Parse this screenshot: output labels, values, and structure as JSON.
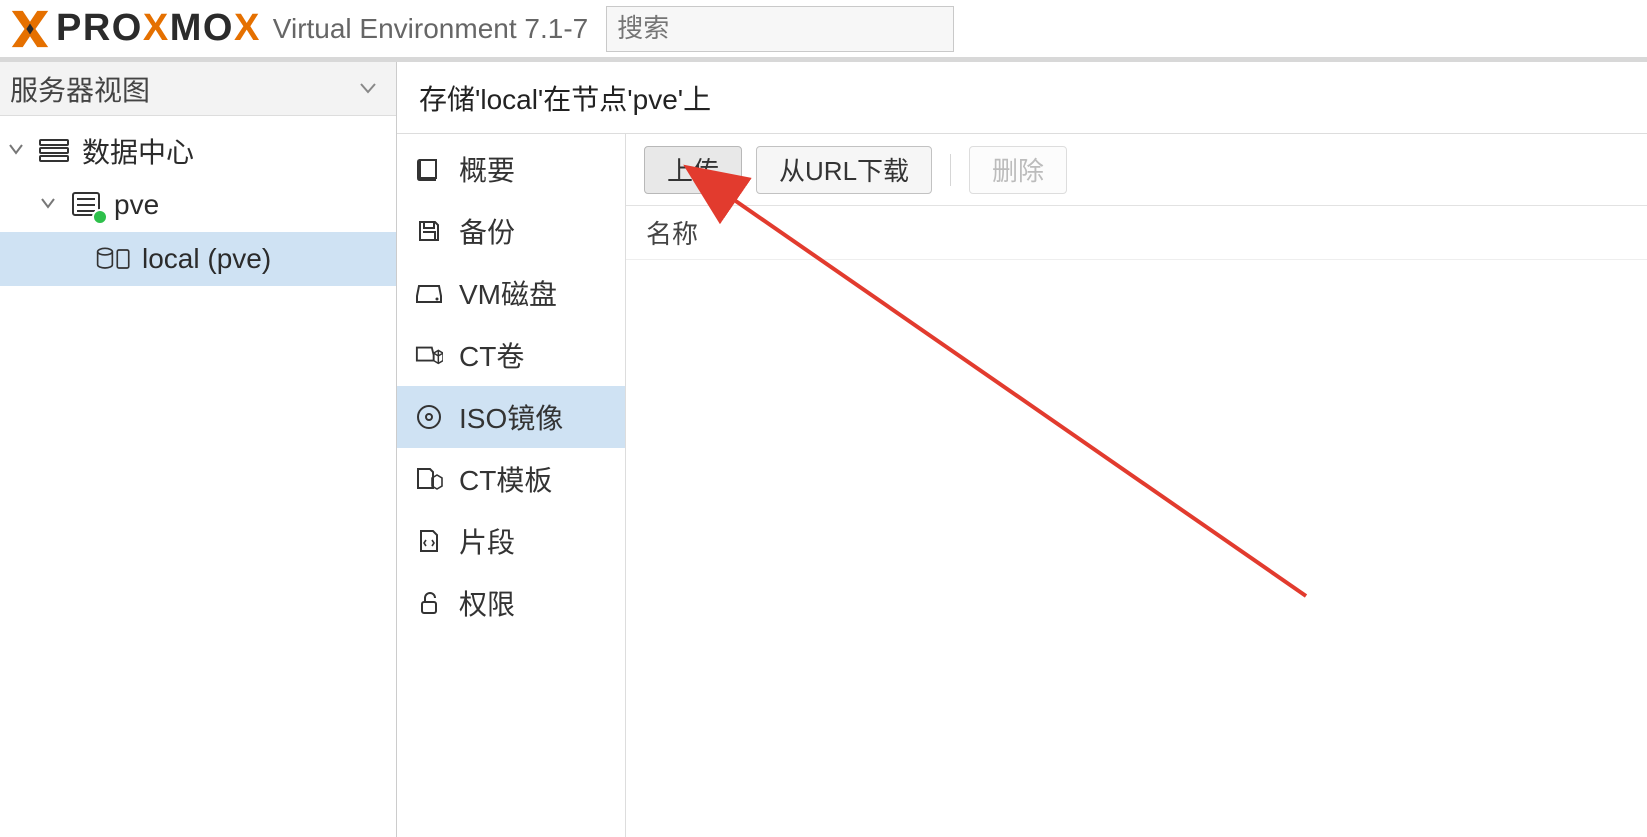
{
  "header": {
    "brand": "PROXMOX",
    "version": "Virtual Environment 7.1-7",
    "search_placeholder": "搜索"
  },
  "sidebar": {
    "view_label": "服务器视图",
    "tree": {
      "datacenter": {
        "label": "数据中心"
      },
      "node": {
        "label": "pve"
      },
      "storage": {
        "label": "local (pve)"
      }
    }
  },
  "content": {
    "title": "存储'local'在节点'pve'上",
    "nav": [
      {
        "key": "summary",
        "label": "概要",
        "selected": false
      },
      {
        "key": "backup",
        "label": "备份",
        "selected": false
      },
      {
        "key": "vmdisk",
        "label": "VM磁盘",
        "selected": false
      },
      {
        "key": "ctvol",
        "label": "CT卷",
        "selected": false
      },
      {
        "key": "iso",
        "label": "ISO镜像",
        "selected": true
      },
      {
        "key": "cttpl",
        "label": "CT模板",
        "selected": false
      },
      {
        "key": "snippets",
        "label": "片段",
        "selected": false
      },
      {
        "key": "perm",
        "label": "权限",
        "selected": false
      }
    ],
    "toolbar": {
      "upload": "上传",
      "download_url": "从URL下载",
      "delete": "删除"
    },
    "grid": {
      "col_name": "名称"
    }
  }
}
